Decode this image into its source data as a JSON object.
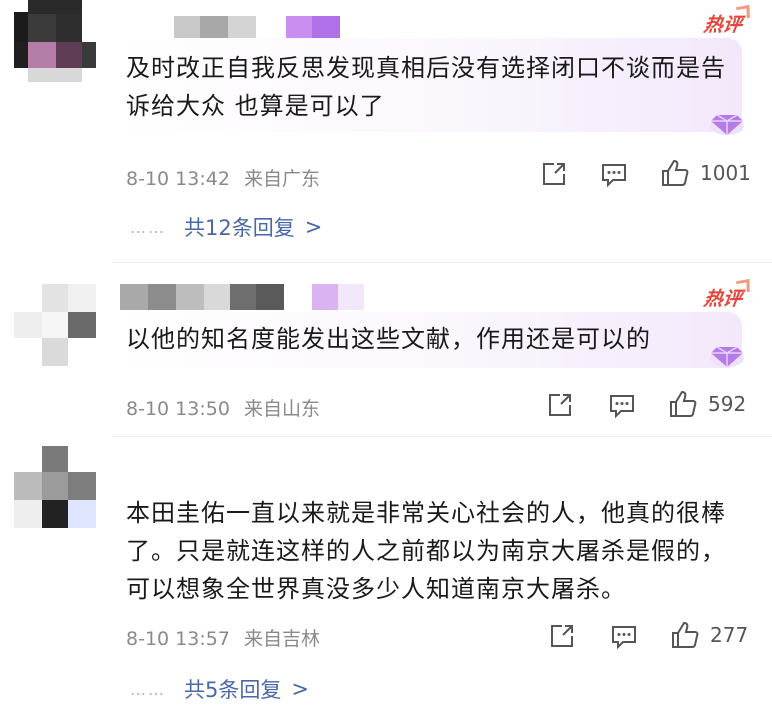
{
  "comments": [
    {
      "text": "及时改正自我反思发现真相后没有选择闭口不谈而是告诉给大众 也算是可以了",
      "hot_badge": "热评",
      "time": "8-10 13:42",
      "location": "来自广东",
      "likes": "1001",
      "replies_label": "共12条回复",
      "replies_chevron": ">"
    },
    {
      "text": "以他的知名度能发出这些文献，作用还是可以的",
      "hot_badge": "热评",
      "time": "8-10 13:50",
      "location": "来自山东",
      "likes": "592"
    },
    {
      "text": "本田圭佑一直以来就是非常关心社会的人，他真的很棒了。只是就连这样的人之前都以为南京大屠杀是假的，可以想象全世界真没多少人知道南京大屠杀。",
      "time": "8-10 13:57",
      "location": "来自吉林",
      "likes": "277",
      "replies_label": "共5条回复",
      "replies_chevron": ">"
    }
  ],
  "reply_dots": "……",
  "icons": {
    "share": "share-icon",
    "comment": "comment-icon",
    "like": "thumbs-up-icon",
    "badge": "diamond-badge-icon"
  },
  "colors": {
    "hot": "#e8443a",
    "reply_link": "#4a68a8",
    "meta": "#8a8a8a",
    "gem": "#b57be8"
  }
}
